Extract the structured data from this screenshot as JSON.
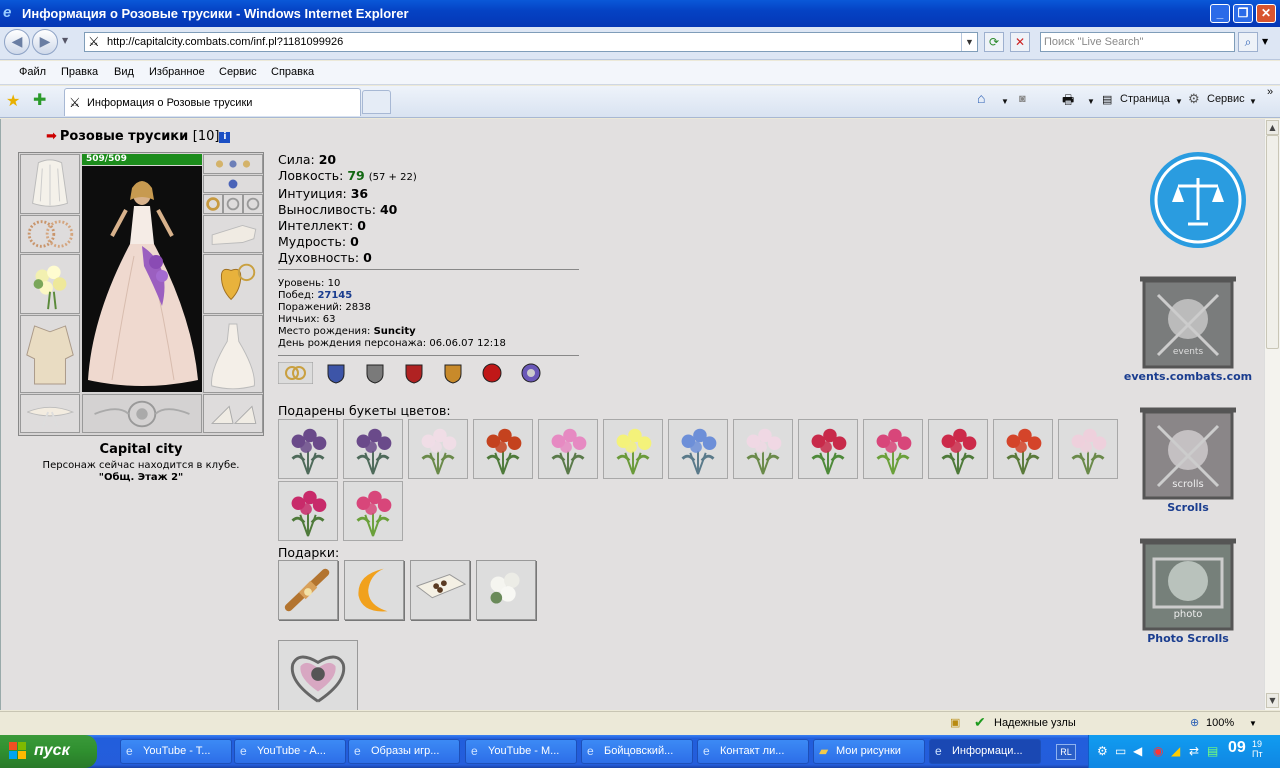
{
  "window": {
    "title": "Информация о Розовые трусики - Windows Internet Explorer"
  },
  "browser": {
    "url": "http://capitalcity.combats.com/inf.pl?1181099926",
    "search_placeholder": "Поиск \"Live Search\"",
    "menu": [
      "Файл",
      "Правка",
      "Вид",
      "Избранное",
      "Сервис",
      "Справка"
    ],
    "tab_title": "Информация о Розовые трусики",
    "toolbar_right": {
      "page": "Страница",
      "service": "Сервис"
    }
  },
  "character": {
    "name": "Розовые трусики",
    "level_badge": "[10]",
    "hp": "509/509",
    "city": "Capital city",
    "location_text": "Персонаж сейчас находится в клубе.",
    "location_room": "\"Общ. Этаж 2\""
  },
  "stats": [
    {
      "label": "Сила:",
      "value": "20",
      "extra": ""
    },
    {
      "label": "Ловкость:",
      "value": "79",
      "extra": "(57 + 22)"
    },
    {
      "label": "Интуиция:",
      "value": "36",
      "extra": ""
    },
    {
      "label": "Выносливость:",
      "value": "40",
      "extra": ""
    },
    {
      "label": "Интеллект:",
      "value": "0",
      "extra": ""
    },
    {
      "label": "Мудрость:",
      "value": "0",
      "extra": ""
    },
    {
      "label": "Духовность:",
      "value": "0",
      "extra": ""
    }
  ],
  "details": [
    {
      "label": "Уровень:",
      "value": "10"
    },
    {
      "label": "Побед:",
      "value": "27145"
    },
    {
      "label": "Поражений:",
      "value": "2838"
    },
    {
      "label": "Ничьих:",
      "value": "63"
    },
    {
      "label": "Место рождения:",
      "value": "Suncity"
    },
    {
      "label": "День рождения персонажа:",
      "value": "06.06.07 12:18"
    }
  ],
  "flowers_title": "Подарены букеты цветов:",
  "gifts_title": "Подарки:",
  "right_links": {
    "events": "events.combats.com",
    "scrolls": "Scrolls",
    "photo": "Photo Scrolls"
  },
  "right_banner_text": {
    "events": "events",
    "scrolls": "scrolls",
    "photo": "photo"
  },
  "status": {
    "trusted": "Надежные узлы",
    "zoom": "100%"
  },
  "taskbar": {
    "start": "пуск",
    "items": [
      "YouTube - T...",
      "YouTube - A...",
      "Образы игр...",
      "YouTube - M...",
      "Бойцовский...",
      "Контакт ли...",
      "Мои рисунки",
      "Информаци..."
    ],
    "lang": "RL",
    "time": "09",
    "time_small": "19",
    "weekday": "Пт"
  },
  "colors": {
    "accent_blue": "#1a3d8f",
    "hp_green": "#1c8c1c",
    "page_bg": "#e2e0e0"
  }
}
